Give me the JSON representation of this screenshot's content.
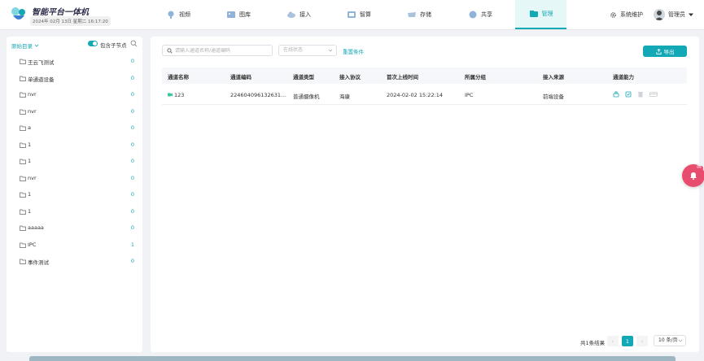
{
  "brand": {
    "title": "智能平台一体机",
    "datetime": "2024年 02月 13日 星期二 16:17:20"
  },
  "nav": [
    {
      "label": "视频",
      "icon": "video-camera-icon"
    },
    {
      "label": "图库",
      "icon": "gallery-icon"
    },
    {
      "label": "接入",
      "icon": "cloud-access-icon"
    },
    {
      "label": "智算",
      "icon": "compute-icon"
    },
    {
      "label": "存储",
      "icon": "storage-icon"
    },
    {
      "label": "共享",
      "icon": "share-icon"
    },
    {
      "label": "管理",
      "icon": "manage-icon",
      "active": true
    }
  ],
  "header_right": {
    "system": "系统维护",
    "user": "管理员"
  },
  "sidebar": {
    "root_label": "原始目录",
    "include_children_label": "包含子节点",
    "include_children": true,
    "items": [
      {
        "label": "王云飞测试",
        "count": "0"
      },
      {
        "label": "单通道设备",
        "count": "0"
      },
      {
        "label": "nvr",
        "count": "0"
      },
      {
        "label": "nvr",
        "count": "0"
      },
      {
        "label": "a",
        "count": "0"
      },
      {
        "label": "1",
        "count": "0"
      },
      {
        "label": "1",
        "count": "0"
      },
      {
        "label": "nvr",
        "count": "0"
      },
      {
        "label": "1",
        "count": "0"
      },
      {
        "label": "1",
        "count": "0"
      },
      {
        "label": "aaaaa",
        "count": "0"
      },
      {
        "label": "IPC",
        "count": "1"
      },
      {
        "label": "事件测试",
        "count": "0"
      }
    ]
  },
  "filters": {
    "search_placeholder": "请输入通道名称/通道编码",
    "status_placeholder": "在线状态",
    "reset_label": "重置条件",
    "export_label": "导出"
  },
  "table": {
    "headers": [
      "通道名称",
      "通道编码",
      "通道类型",
      "接入协议",
      "首次上线时间",
      "所属分组",
      "接入来源",
      "通道能力"
    ],
    "rows": [
      {
        "name": "123",
        "code": "224604096132631...",
        "type": "普通摄像机",
        "protocol": "海康",
        "first_online": "2024-02-02 15:22:14",
        "group": "IPC",
        "source": "前端设备"
      }
    ]
  },
  "pagination": {
    "total": "共1条结果",
    "current": "1",
    "page_size": "10 条/页"
  },
  "notification": {
    "badge": "99"
  },
  "colors": {
    "accent": "#13a8b5",
    "bell": "#e84c6f"
  }
}
